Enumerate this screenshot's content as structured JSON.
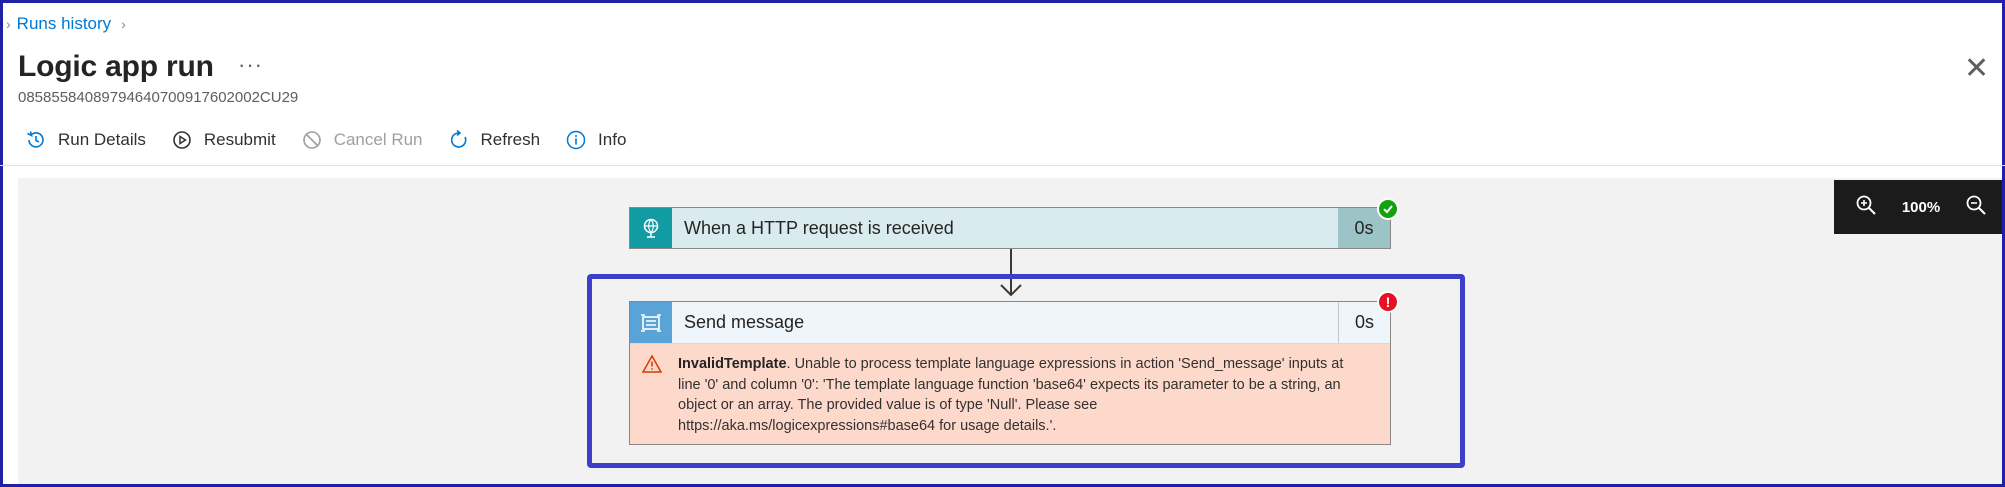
{
  "breadcrumb": {
    "link": "Runs history"
  },
  "header": {
    "title": "Logic app run",
    "more": "···",
    "run_id": "08585584089794640700917602002CU29"
  },
  "toolbar": {
    "run_details": "Run Details",
    "resubmit": "Resubmit",
    "cancel_run": "Cancel Run",
    "refresh": "Refresh",
    "info": "Info"
  },
  "zoom": {
    "level": "100%"
  },
  "steps": {
    "trigger": {
      "label": "When a HTTP request is received",
      "duration": "0s",
      "status": "succeeded"
    },
    "action": {
      "label": "Send message",
      "duration": "0s",
      "status": "failed",
      "error_code": "InvalidTemplate",
      "error_message": ". Unable to process template language expressions in action 'Send_message' inputs at line '0' and column '0': 'The template language function 'base64' expects its parameter to be a string, an object or an array. The provided value is of type 'Null'. Please see https://aka.ms/logicexpressions#base64 for usage details.'."
    }
  },
  "colors": {
    "accent": "#0078d4",
    "success": "#13a10e",
    "error": "#e81123",
    "highlight": "#3d3fcc",
    "error_bg": "#fdd9cc"
  }
}
